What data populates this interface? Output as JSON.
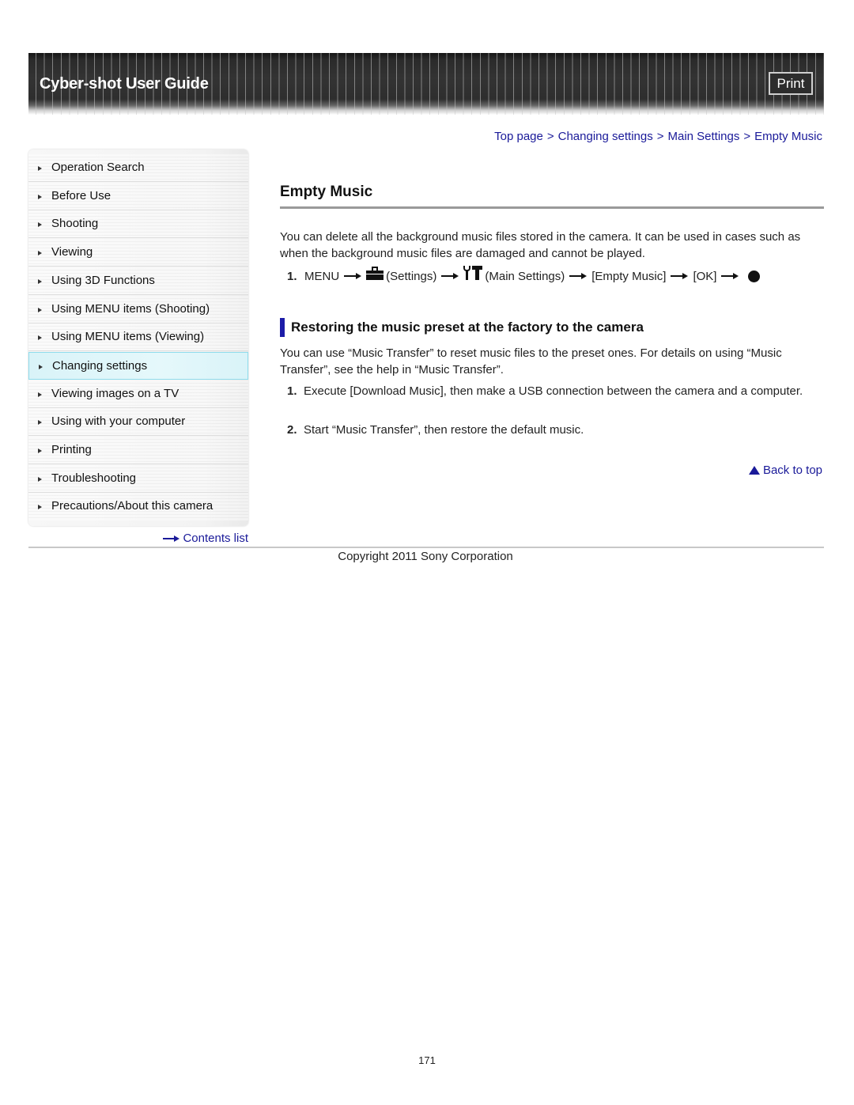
{
  "header": {
    "title": "Cyber-shot User Guide",
    "print_label": "Print"
  },
  "breadcrumb": {
    "items": [
      "Top page",
      "Changing settings",
      "Main Settings",
      "Empty Music"
    ],
    "separator": ">"
  },
  "sidebar": {
    "items": [
      {
        "label": "Operation Search",
        "active": false
      },
      {
        "label": "Before Use",
        "active": false
      },
      {
        "label": "Shooting",
        "active": false
      },
      {
        "label": "Viewing",
        "active": false
      },
      {
        "label": "Using 3D Functions",
        "active": false
      },
      {
        "label": "Using MENU items (Shooting)",
        "active": false
      },
      {
        "label": "Using MENU items (Viewing)",
        "active": false
      },
      {
        "label": "Changing settings",
        "active": true
      },
      {
        "label": "Viewing images on a TV",
        "active": false
      },
      {
        "label": "Using with your computer",
        "active": false
      },
      {
        "label": "Printing",
        "active": false
      },
      {
        "label": "Troubleshooting",
        "active": false
      },
      {
        "label": "Precautions/About this camera",
        "active": false
      }
    ],
    "contents_link": "Contents list"
  },
  "main": {
    "title": "Empty Music",
    "intro": "You can delete all the background music files stored in the camera. It can be used in cases such as when the background music files are damaged and cannot be played.",
    "step": {
      "number": "1.",
      "menu": "MENU",
      "settings": "(Settings)",
      "main_settings": "(Main Settings)",
      "item": "[Empty Music]",
      "ok": "[OK]",
      "icons": [
        "settings-toolbox-icon",
        "main-settings-tools-icon",
        "center-button-dot-icon"
      ]
    },
    "section": {
      "heading": "Restoring the music preset at the factory to the camera",
      "text": "You can use “Music Transfer” to reset music files to the preset ones. For details on using “Music Transfer”, see the help in “Music Transfer”.",
      "steps": [
        {
          "number": "1.",
          "text": "Execute [Download Music], then make a USB connection between the camera and a computer."
        },
        {
          "number": "2.",
          "text": "Start “Music Transfer”, then restore the default music."
        }
      ]
    },
    "back_to_top": "Back to top"
  },
  "footer": {
    "copyright": "Copyright 2011 Sony Corporation",
    "page_number": "171"
  },
  "colors": {
    "link": "#1a1a99",
    "heading_bar": "#1c1ca8",
    "active_nav_bg": "#d9f3f8",
    "active_nav_border": "#8fdcec",
    "header_bg": "#2e2e2e"
  }
}
